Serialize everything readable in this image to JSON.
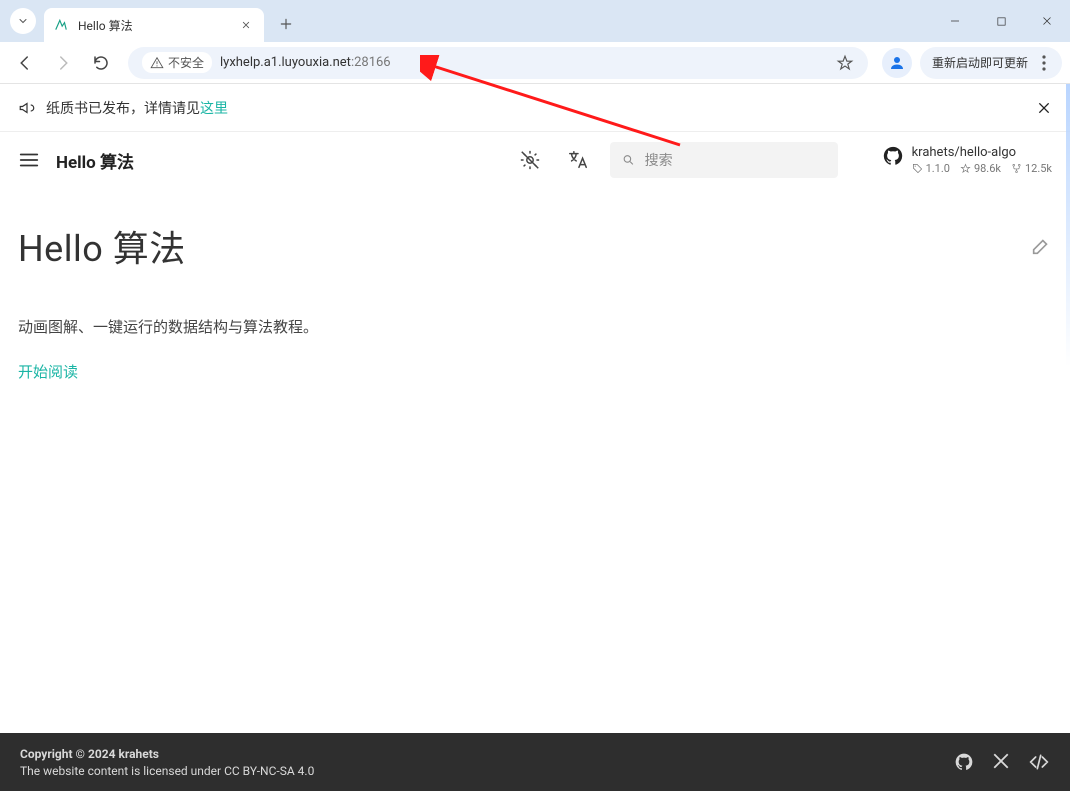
{
  "browser": {
    "tab_title": "Hello 算法",
    "security_label": "不安全",
    "url_host": "lyxhelp.a1.luyouxia.net",
    "url_port": ":28166",
    "update_label": "重新启动即可更新"
  },
  "announcement": {
    "text_prefix": "纸质书已发布，详情请见",
    "link_text": "这里"
  },
  "header": {
    "site_title": "Hello 算法",
    "search_placeholder": "搜索",
    "repo": {
      "name": "krahets/hello-algo",
      "version": "1.1.0",
      "stars": "98.6k",
      "forks": "12.5k"
    }
  },
  "main": {
    "page_title": "Hello 算法",
    "subtitle": "动画图解、一键运行的数据结构与算法教程。",
    "read_link": "开始阅读"
  },
  "footer": {
    "copyright": "Copyright © 2024 krahets",
    "license": "The website content is licensed under CC BY-NC-SA 4.0"
  }
}
